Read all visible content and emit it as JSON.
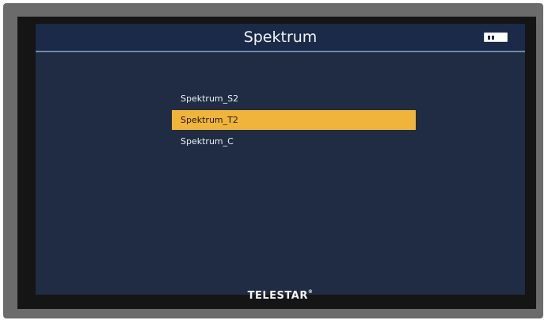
{
  "window": {
    "title": "Spektrum"
  },
  "status": {
    "battery_icon": "battery-icon"
  },
  "menu": {
    "items": [
      {
        "label": "Spektrum_S2",
        "selected": false
      },
      {
        "label": "Spektrum_T2",
        "selected": true
      },
      {
        "label": "Spektrum_C",
        "selected": false
      }
    ]
  },
  "footer": {
    "brand": "TELESTAR",
    "brand_mark": "®"
  },
  "colors": {
    "screen_bg": "#1f2c44",
    "title_bar_bg": "#1b2a48",
    "selection": "#f0b43a",
    "text": "#eef0f4",
    "bezel": "#6b6b6b"
  }
}
